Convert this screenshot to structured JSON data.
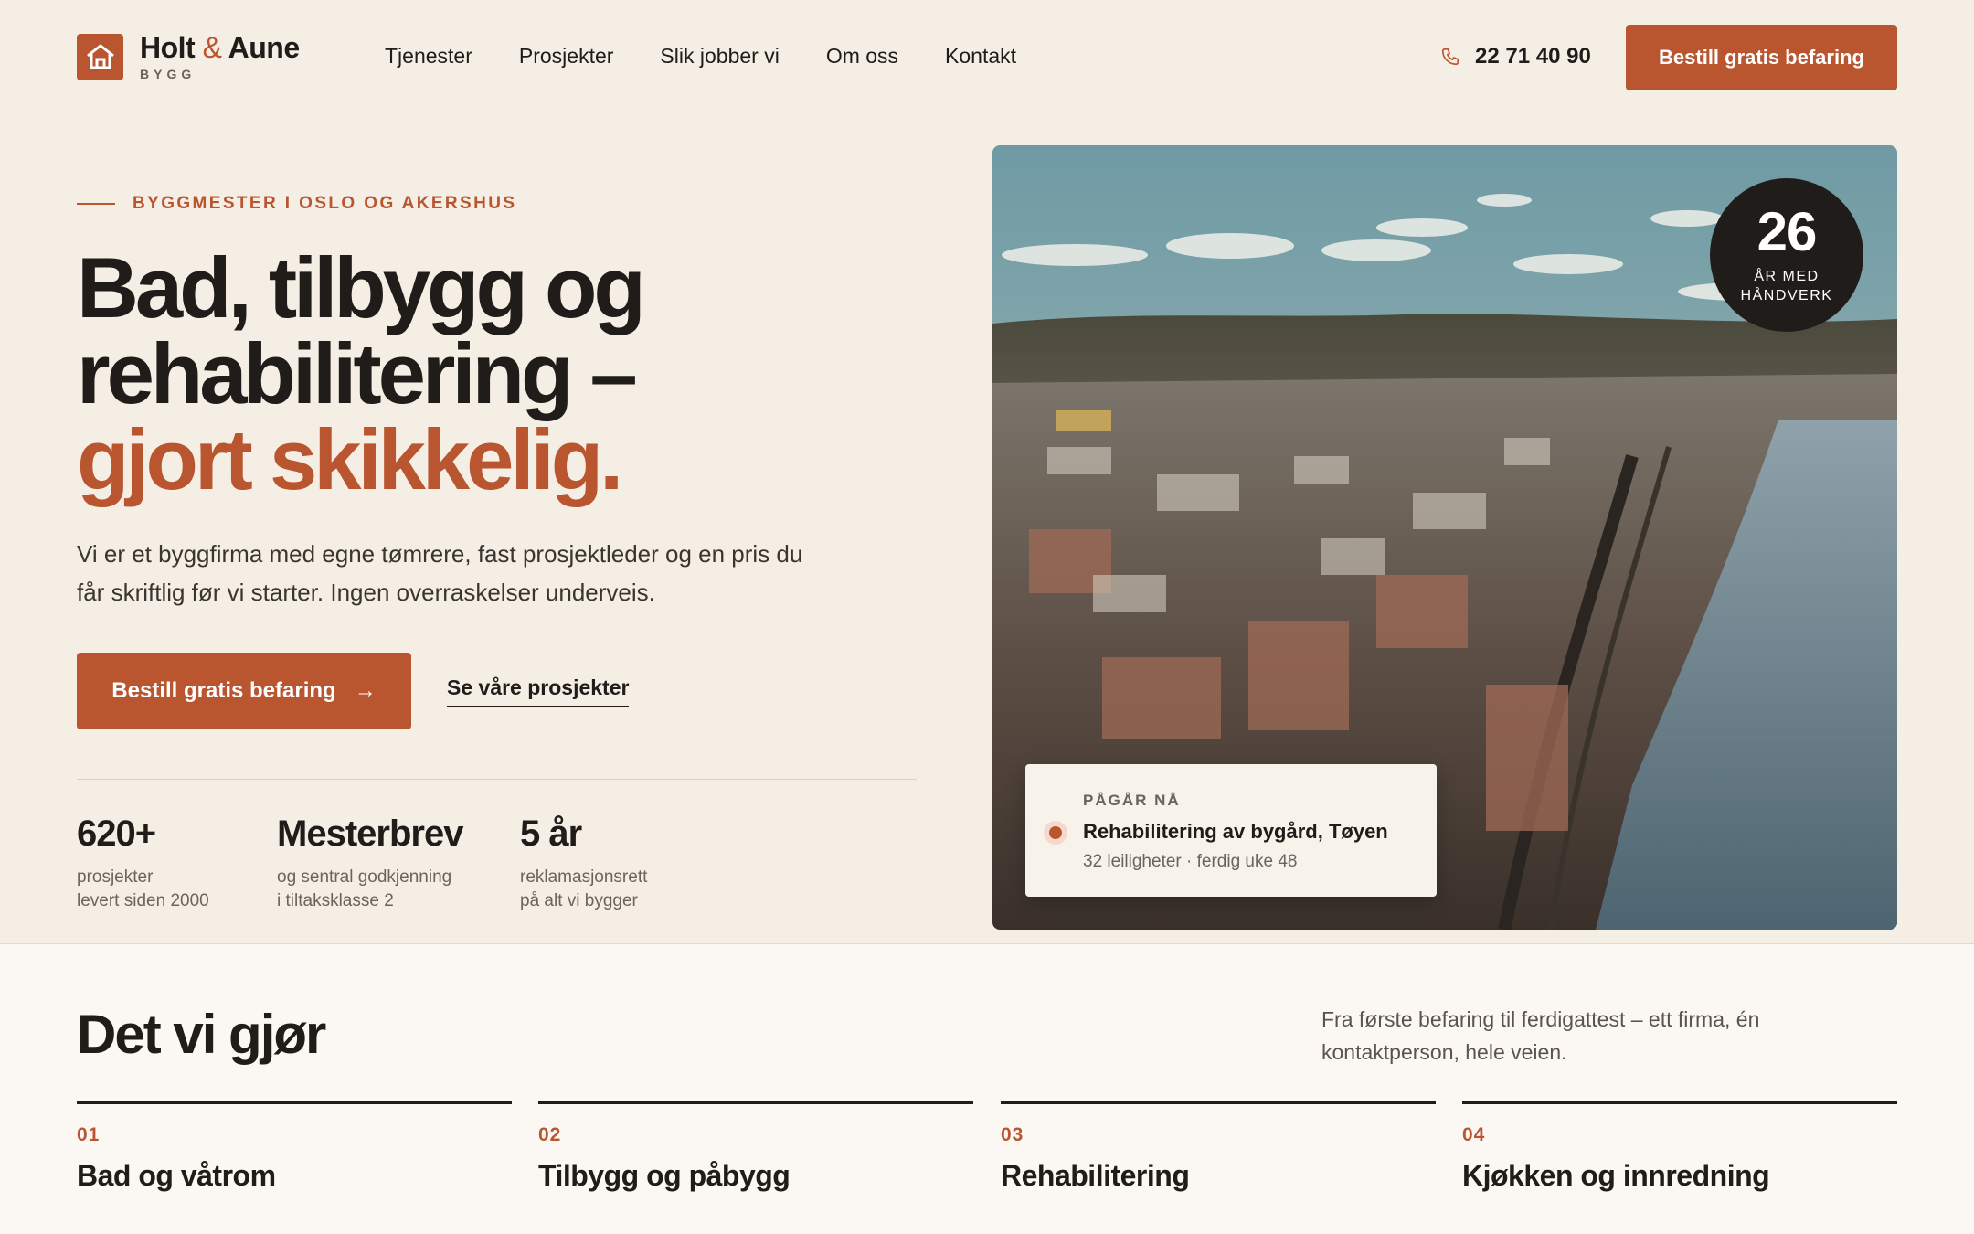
{
  "brand": {
    "name_part1": "Holt",
    "name_amp": "&",
    "name_part2": "Aune",
    "sub": "BYGG",
    "accent_color": "#b9552f",
    "icon": "house-icon"
  },
  "nav": {
    "items": [
      {
        "label": "Tjenester"
      },
      {
        "label": "Prosjekter"
      },
      {
        "label": "Slik jobber vi"
      },
      {
        "label": "Om oss"
      },
      {
        "label": "Kontakt"
      }
    ]
  },
  "header": {
    "phone_icon": "phone-icon",
    "phone": "22 71 40 90",
    "cta_label": "Bestill gratis befaring"
  },
  "hero": {
    "eyebrow": "BYGGMESTER I OSLO OG AKERSHUS",
    "title_line1": "Bad, tilbygg og",
    "title_line2": "rehabilitering –",
    "title_accent": "gjort skikkelig.",
    "lead": "Vi er et byggfirma med egne tømrere, fast prosjektleder og en pris du får skriftlig før vi starter. Ingen overraskelser underveis.",
    "cta_label": "Bestill gratis befaring",
    "cta_arrow": "→",
    "secondary_label": "Se våre prosjekter",
    "stats": [
      {
        "value": "620+",
        "label_line1": "prosjekter",
        "label_line2": "levert siden 2000"
      },
      {
        "value": "Mesterbrev",
        "label_line1": "og sentral godkjenning",
        "label_line2": "i tiltaksklasse 2"
      },
      {
        "value": "5 år",
        "label_line1": "reklamasjonsrett",
        "label_line2": "på alt vi bygger"
      }
    ]
  },
  "badge": {
    "number": "26",
    "label": "ÅR MED HÅNDVERK"
  },
  "status_card": {
    "eyebrow": "PÅGÅR NÅ",
    "title": "Rehabilitering av bygård, Tøyen",
    "meta": "32 leiligheter · ferdig uke 48"
  },
  "services": {
    "title": "Det vi gjør",
    "description": "Fra første befaring til ferdigattest – ett firma, én kontaktperson, hele veien.",
    "items": [
      {
        "num": "01",
        "title": "Bad og våtrom"
      },
      {
        "num": "02",
        "title": "Tilbygg og påbygg"
      },
      {
        "num": "03",
        "title": "Rehabilitering"
      },
      {
        "num": "04",
        "title": "Kjøkken og innredning"
      }
    ]
  }
}
